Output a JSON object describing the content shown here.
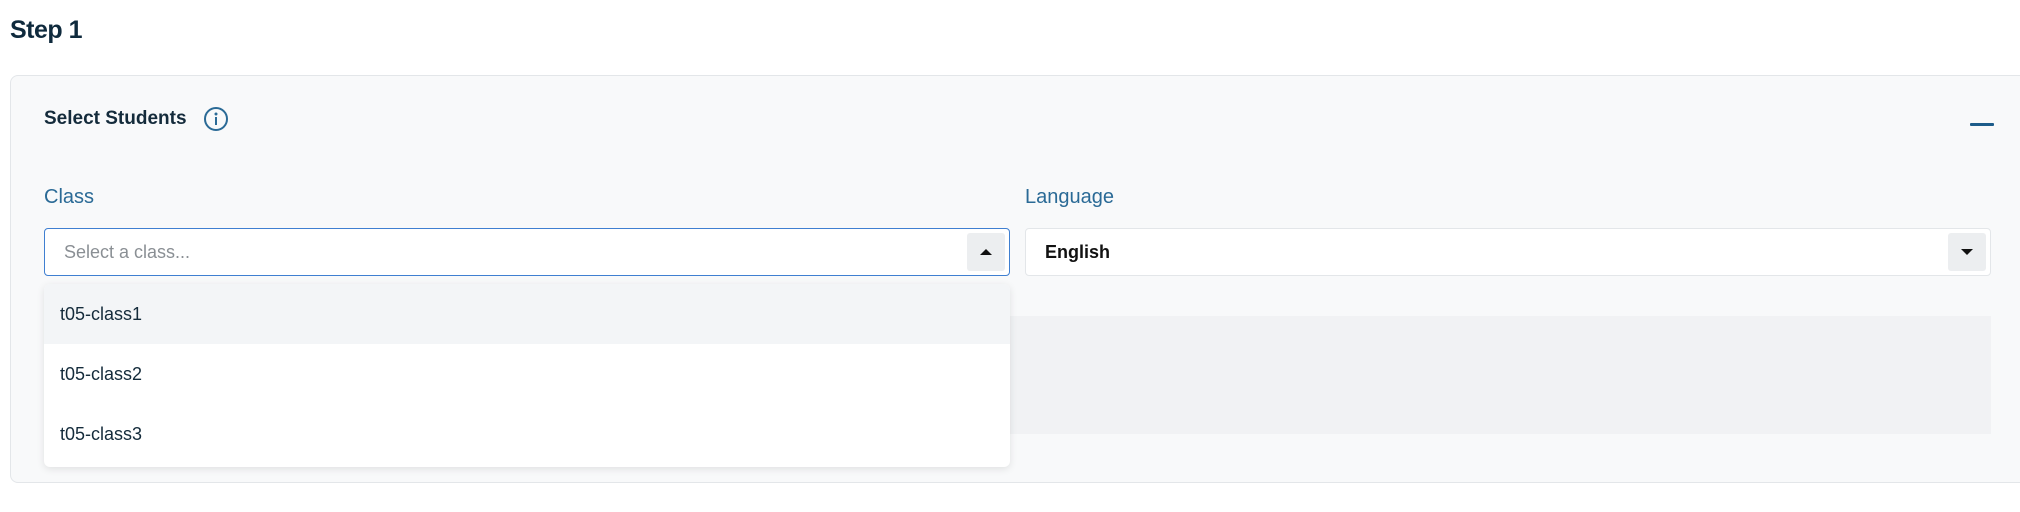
{
  "step": {
    "title": "Step 1"
  },
  "card": {
    "title": "Select Students",
    "info_icon": "info-circle-icon",
    "collapse_icon": "minus-icon"
  },
  "class_field": {
    "label": "Class",
    "placeholder": "Select a class...",
    "arrow_icon": "caret-up-icon",
    "options": [
      "t05-class1",
      "t05-class2",
      "t05-class3"
    ],
    "highlighted_option": "t05-class1"
  },
  "language_field": {
    "label": "Language",
    "value": "English",
    "arrow_icon": "caret-down-icon"
  },
  "colors": {
    "accent": "#2a6a96",
    "focus_border": "#3f7fd1",
    "title": "#0f2a3d"
  }
}
